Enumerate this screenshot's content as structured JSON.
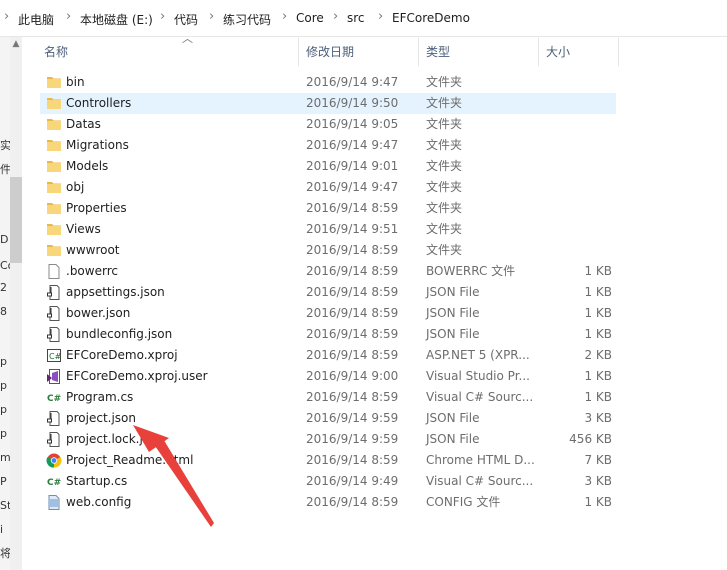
{
  "breadcrumb": [
    "此电脑",
    "本地磁盘 (E:)",
    "代码",
    "练习代码",
    "Core",
    "src",
    "EFCoreDemo"
  ],
  "columns": {
    "name": "名称",
    "date": "修改日期",
    "type": "类型",
    "size": "大小"
  },
  "left_fragments": [
    "实",
    "件",
    "D",
    "Co",
    "2",
    "8",
    "p",
    "p",
    "p",
    "p",
    "m",
    "P",
    "St",
    "i",
    "将"
  ],
  "files": [
    {
      "name": "bin",
      "date": "2016/9/14 9:47",
      "type": "文件夹",
      "size": "",
      "icon": "folder-icon"
    },
    {
      "name": "Controllers",
      "date": "2016/9/14 9:50",
      "type": "文件夹",
      "size": "",
      "icon": "folder-icon"
    },
    {
      "name": "Datas",
      "date": "2016/9/14 9:05",
      "type": "文件夹",
      "size": "",
      "icon": "folder-icon"
    },
    {
      "name": "Migrations",
      "date": "2016/9/14 9:47",
      "type": "文件夹",
      "size": "",
      "icon": "folder-icon"
    },
    {
      "name": "Models",
      "date": "2016/9/14 9:01",
      "type": "文件夹",
      "size": "",
      "icon": "folder-icon"
    },
    {
      "name": "obj",
      "date": "2016/9/14 9:47",
      "type": "文件夹",
      "size": "",
      "icon": "folder-icon"
    },
    {
      "name": "Properties",
      "date": "2016/9/14 8:59",
      "type": "文件夹",
      "size": "",
      "icon": "folder-icon"
    },
    {
      "name": "Views",
      "date": "2016/9/14 9:51",
      "type": "文件夹",
      "size": "",
      "icon": "folder-icon"
    },
    {
      "name": "wwwroot",
      "date": "2016/9/14 8:59",
      "type": "文件夹",
      "size": "",
      "icon": "folder-icon"
    },
    {
      "name": ".bowerrc",
      "date": "2016/9/14 8:59",
      "type": "BOWERRC 文件",
      "size": "1 KB",
      "icon": "blank-file-icon"
    },
    {
      "name": "appsettings.json",
      "date": "2016/9/14 8:59",
      "type": "JSON File",
      "size": "1 KB",
      "icon": "json-file-icon"
    },
    {
      "name": "bower.json",
      "date": "2016/9/14 8:59",
      "type": "JSON File",
      "size": "1 KB",
      "icon": "json-file-icon"
    },
    {
      "name": "bundleconfig.json",
      "date": "2016/9/14 8:59",
      "type": "JSON File",
      "size": "1 KB",
      "icon": "json-file-icon"
    },
    {
      "name": "EFCoreDemo.xproj",
      "date": "2016/9/14 8:59",
      "type": "ASP.NET 5 (XPR...",
      "size": "2 KB",
      "icon": "xproj-file-icon"
    },
    {
      "name": "EFCoreDemo.xproj.user",
      "date": "2016/9/14 9:00",
      "type": "Visual Studio Pr...",
      "size": "1 KB",
      "icon": "visual-studio-icon"
    },
    {
      "name": "Program.cs",
      "date": "2016/9/14 8:59",
      "type": "Visual C# Sourc...",
      "size": "1 KB",
      "icon": "csharp-file-icon"
    },
    {
      "name": "project.json",
      "date": "2016/9/14 9:59",
      "type": "JSON File",
      "size": "3 KB",
      "icon": "json-file-icon"
    },
    {
      "name": "project.lock.json",
      "date": "2016/9/14 9:59",
      "type": "JSON File",
      "size": "456 KB",
      "icon": "json-file-icon"
    },
    {
      "name": "Project_Readme.html",
      "date": "2016/9/14 8:59",
      "type": "Chrome HTML D...",
      "size": "7 KB",
      "icon": "chrome-icon"
    },
    {
      "name": "Startup.cs",
      "date": "2016/9/14 9:49",
      "type": "Visual C# Sourc...",
      "size": "3 KB",
      "icon": "csharp-file-icon"
    },
    {
      "name": "web.config",
      "date": "2016/9/14 8:59",
      "type": "CONFIG 文件",
      "size": "1 KB",
      "icon": "config-file-icon"
    }
  ],
  "selected_index": 1,
  "colors": {
    "selection": "#e5f3ff",
    "arrow": "#e8403a",
    "folder": "#f7d779",
    "header_text": "#4c607a"
  }
}
